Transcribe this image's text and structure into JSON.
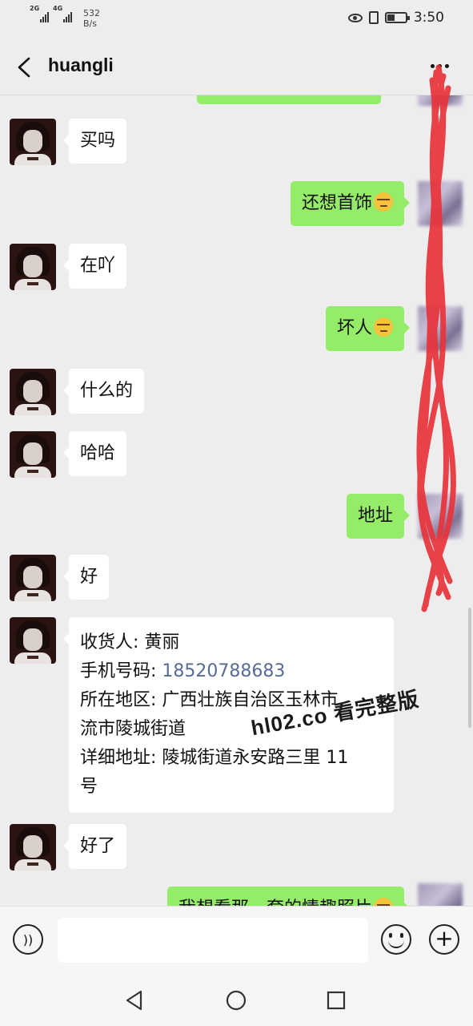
{
  "status_bar": {
    "signal_1": "2G",
    "signal_2": "4G",
    "rate_value": "532",
    "rate_unit": "B/s",
    "time": "3:50"
  },
  "header": {
    "title": "huangli"
  },
  "messages": [
    {
      "side": "left",
      "text": "买吗"
    },
    {
      "side": "right",
      "text": "还想首饰",
      "emoji": "smirk-emoji"
    },
    {
      "side": "left",
      "text": "在吖"
    },
    {
      "side": "right",
      "text": "坏人",
      "emoji": "smirk-emoji"
    },
    {
      "side": "left",
      "text": "什么的"
    },
    {
      "side": "left",
      "text": "哈哈"
    },
    {
      "side": "right",
      "text": "地址"
    },
    {
      "side": "left",
      "text": "好"
    },
    {
      "side": "left",
      "address": {
        "line1": "收货人: 黄丽",
        "line2_label": "手机号码: ",
        "phone": "18520788683",
        "line3": "所在地区: 广西壮族自治区玉林市",
        "line4": "流市陵城街道",
        "line5": "详细地址: 陵城街道永安路三里 11",
        "line6": "号"
      }
    },
    {
      "side": "left",
      "text": "好了"
    },
    {
      "side": "right",
      "text": "我想看那一套的情趣照片",
      "emoji": "smirk-emoji"
    }
  ],
  "watermark": "hl02.co 看完整版",
  "icons": {
    "back": "back-arrow-icon",
    "more": "more-dots-icon",
    "voice": "voice-icon",
    "emoji": "emoji-icon",
    "plus": "plus-icon"
  },
  "colors": {
    "sent_bubble": "#95ec69",
    "received_bubble": "#ffffff",
    "background": "#ededed",
    "phone_link": "#576b95",
    "scribble": "#e8333a"
  }
}
